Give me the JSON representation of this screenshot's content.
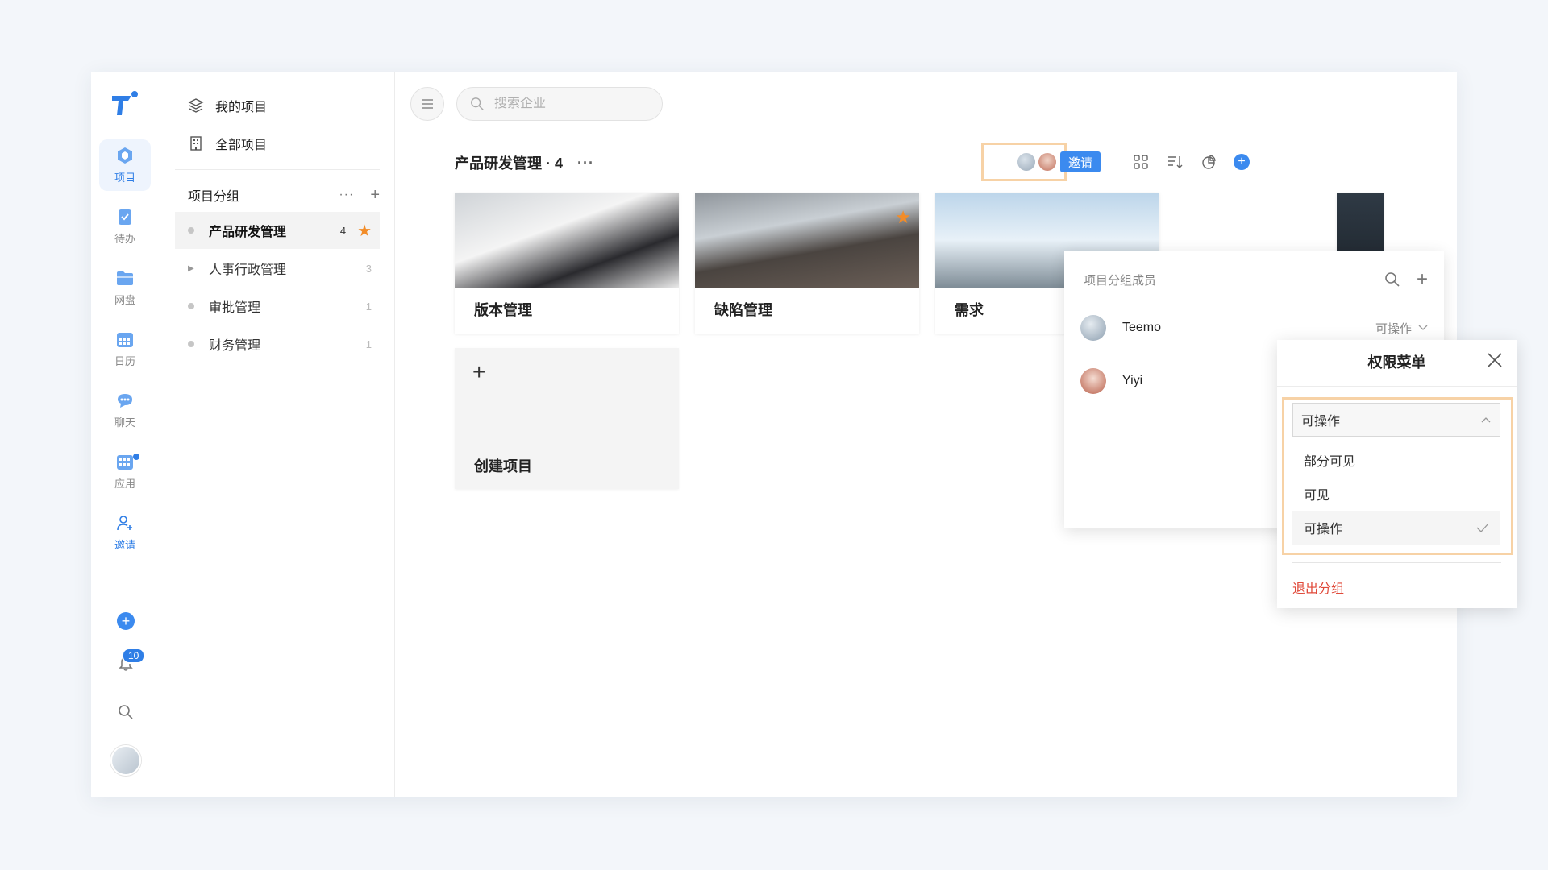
{
  "rail": {
    "items": [
      {
        "label": "项目",
        "icon": "project-icon",
        "active": true
      },
      {
        "label": "待办",
        "icon": "todo-icon"
      },
      {
        "label": "网盘",
        "icon": "folder-icon"
      },
      {
        "label": "日历",
        "icon": "calendar-icon"
      },
      {
        "label": "聊天",
        "icon": "chat-icon"
      },
      {
        "label": "应用",
        "icon": "apps-icon"
      },
      {
        "label": "邀请",
        "icon": "invite-icon"
      }
    ],
    "notifications_badge": "10"
  },
  "sidebar": {
    "my_projects": "我的项目",
    "all_projects": "全部项目",
    "group_header": "项目分组",
    "groups": [
      {
        "name": "产品研发管理",
        "count": "4",
        "active": true,
        "starred": true
      },
      {
        "name": "人事行政管理",
        "count": "3",
        "expandable": true
      },
      {
        "name": "审批管理",
        "count": "1"
      },
      {
        "name": "财务管理",
        "count": "1"
      }
    ]
  },
  "main": {
    "search_placeholder": "搜索企业",
    "title": "产品研发管理 · 4",
    "invite_label": "邀请",
    "cards": [
      {
        "label": "版本管理"
      },
      {
        "label": "缺陷管理",
        "starred": true
      },
      {
        "label": "需求"
      },
      {
        "label": ""
      }
    ],
    "create_label": "创建项目"
  },
  "members_popover": {
    "title": "项目分组成员",
    "members": [
      {
        "name": "Teemo",
        "permission": "可操作"
      },
      {
        "name": "Yiyi",
        "permission": ""
      }
    ]
  },
  "permission_menu": {
    "title": "权限菜单",
    "current": "可操作",
    "options": [
      "部分可见",
      "可见",
      "可操作"
    ],
    "selected_index": 2,
    "exit_label": "退出分组"
  },
  "colors": {
    "accent": "#3b8aef",
    "star": "#f28c28",
    "highlight": "#f7d2a6",
    "danger": "#e04a3a"
  }
}
